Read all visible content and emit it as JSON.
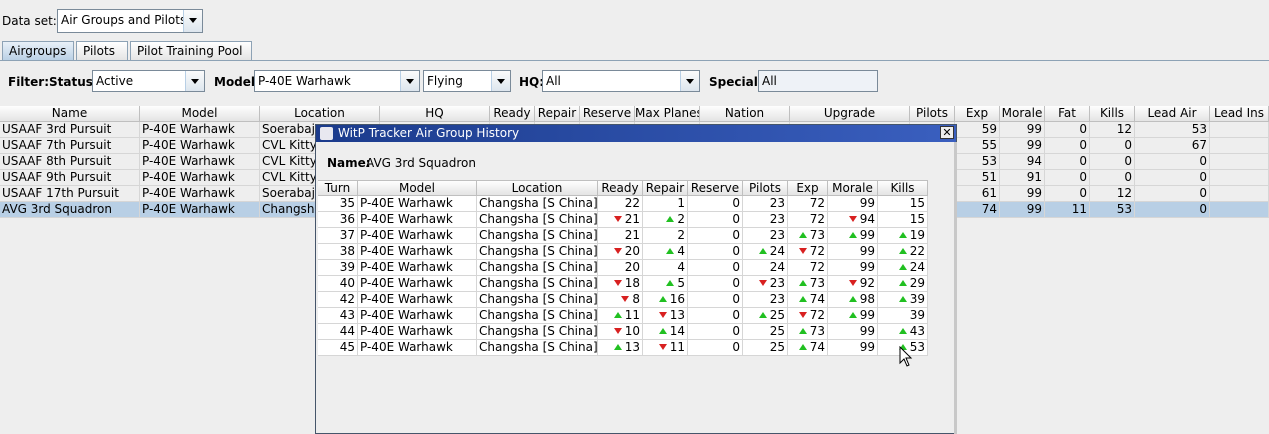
{
  "dataset": {
    "label": "Data set:",
    "value": "Air Groups and Pilots"
  },
  "tabs": [
    "Airgroups",
    "Pilots",
    "Pilot Training Pool"
  ],
  "filter": {
    "label": "Filter:",
    "status_label": "Status:",
    "status_value": "Active",
    "model_label": "Model:",
    "model_value": "P-40E Warhawk",
    "mode_value": "Flying",
    "hq_label": "HQ:",
    "hq_value": "All",
    "special_label": "Special:",
    "special_value": "All"
  },
  "main_table": {
    "columns": [
      "Name",
      "Model",
      "Location",
      "HQ",
      "Ready",
      "Repair",
      "Reserve",
      "Max Planes",
      "Nation",
      "Upgrade",
      "Pilots",
      "Exp",
      "Morale",
      "Fat",
      "Kills",
      "Lead Air",
      "Lead Ins"
    ],
    "rows": [
      {
        "name": "USAAF 3rd Pursuit",
        "model": "P-40E Warhawk",
        "location": "Soerabaj",
        "exp": "59",
        "morale": "99",
        "fat": "0",
        "kills": "12",
        "lead_air": "53"
      },
      {
        "name": "USAAF 7th Pursuit",
        "model": "P-40E Warhawk",
        "location": "CVL Kittyh",
        "exp": "55",
        "morale": "99",
        "fat": "0",
        "kills": "0",
        "lead_air": "67"
      },
      {
        "name": "USAAF 8th Pursuit",
        "model": "P-40E Warhawk",
        "location": "CVL Kittyh",
        "exp": "53",
        "morale": "94",
        "fat": "0",
        "kills": "0",
        "lead_air": "0"
      },
      {
        "name": "USAAF 9th Pursuit",
        "model": "P-40E Warhawk",
        "location": "CVL Kittyh",
        "exp": "51",
        "morale": "91",
        "fat": "0",
        "kills": "0",
        "lead_air": "0"
      },
      {
        "name": "USAAF 17th Pursuit",
        "model": "P-40E Warhawk",
        "location": "Soerabaj",
        "exp": "61",
        "morale": "99",
        "fat": "0",
        "kills": "12",
        "lead_air": "0"
      },
      {
        "name": "AVG 3rd Squadron",
        "model": "P-40E Warhawk",
        "location": "Changsh",
        "exp": "74",
        "morale": "99",
        "fat": "11",
        "kills": "53",
        "lead_air": "0"
      }
    ]
  },
  "dialog": {
    "title": "WitP Tracker Air Group History",
    "name_label": "Name:",
    "name_value": "AVG 3rd Squadron",
    "close_glyph": "✕",
    "columns": [
      "Turn",
      "Model",
      "Location",
      "Ready",
      "Repair",
      "Reserve",
      "Pilots",
      "Exp",
      "Morale",
      "Kills"
    ],
    "rows": [
      {
        "turn": "35",
        "model": "P-40E Warhawk",
        "location": "Changsha [S China]",
        "ready": "22",
        "repair": "1",
        "reserve": "0",
        "pilots": "23",
        "exp": "72",
        "morale": "99",
        "kills": "15",
        "tr": {}
      },
      {
        "turn": "36",
        "model": "P-40E Warhawk",
        "location": "Changsha [S China]",
        "ready": "21",
        "repair": "2",
        "reserve": "0",
        "pilots": "23",
        "exp": "72",
        "morale": "94",
        "kills": "15",
        "tr": {
          "ready": "down",
          "repair": "up",
          "morale": "down"
        }
      },
      {
        "turn": "37",
        "model": "P-40E Warhawk",
        "location": "Changsha [S China]",
        "ready": "21",
        "repair": "2",
        "reserve": "0",
        "pilots": "23",
        "exp": "73",
        "morale": "99",
        "kills": "19",
        "tr": {
          "exp": "up",
          "morale": "up",
          "kills": "up"
        }
      },
      {
        "turn": "38",
        "model": "P-40E Warhawk",
        "location": "Changsha [S China]",
        "ready": "20",
        "repair": "4",
        "reserve": "0",
        "pilots": "24",
        "exp": "72",
        "morale": "99",
        "kills": "22",
        "tr": {
          "ready": "down",
          "repair": "up",
          "pilots": "up",
          "exp": "down",
          "kills": "up"
        }
      },
      {
        "turn": "39",
        "model": "P-40E Warhawk",
        "location": "Changsha [S China]",
        "ready": "20",
        "repair": "4",
        "reserve": "0",
        "pilots": "24",
        "exp": "72",
        "morale": "99",
        "kills": "24",
        "tr": {
          "kills": "up"
        }
      },
      {
        "turn": "40",
        "model": "P-40E Warhawk",
        "location": "Changsha [S China]",
        "ready": "18",
        "repair": "5",
        "reserve": "0",
        "pilots": "23",
        "exp": "73",
        "morale": "92",
        "kills": "29",
        "tr": {
          "ready": "down",
          "repair": "up",
          "pilots": "down",
          "exp": "up",
          "morale": "down",
          "kills": "up"
        }
      },
      {
        "turn": "42",
        "model": "P-40E Warhawk",
        "location": "Changsha [S China]",
        "ready": "8",
        "repair": "16",
        "reserve": "0",
        "pilots": "23",
        "exp": "74",
        "morale": "98",
        "kills": "39",
        "tr": {
          "ready": "down",
          "repair": "up",
          "exp": "up",
          "morale": "up",
          "kills": "up"
        }
      },
      {
        "turn": "43",
        "model": "P-40E Warhawk",
        "location": "Changsha [S China]",
        "ready": "11",
        "repair": "13",
        "reserve": "0",
        "pilots": "25",
        "exp": "72",
        "morale": "99",
        "kills": "39",
        "tr": {
          "ready": "up",
          "repair": "down",
          "pilots": "up",
          "exp": "down",
          "morale": "up"
        }
      },
      {
        "turn": "44",
        "model": "P-40E Warhawk",
        "location": "Changsha [S China]",
        "ready": "10",
        "repair": "14",
        "reserve": "0",
        "pilots": "25",
        "exp": "73",
        "morale": "99",
        "kills": "43",
        "tr": {
          "ready": "down",
          "repair": "up",
          "exp": "up",
          "kills": "up"
        }
      },
      {
        "turn": "45",
        "model": "P-40E Warhawk",
        "location": "Changsha [S China]",
        "ready": "13",
        "repair": "11",
        "reserve": "0",
        "pilots": "25",
        "exp": "74",
        "morale": "99",
        "kills": "53",
        "tr": {
          "ready": "up",
          "repair": "down",
          "exp": "up",
          "kills": "up"
        }
      }
    ]
  },
  "colors": {
    "selection": "#b8cfe5",
    "up_arrow": "#21c021",
    "down_arrow": "#d82020",
    "title_bar": "#1b3b8c"
  }
}
